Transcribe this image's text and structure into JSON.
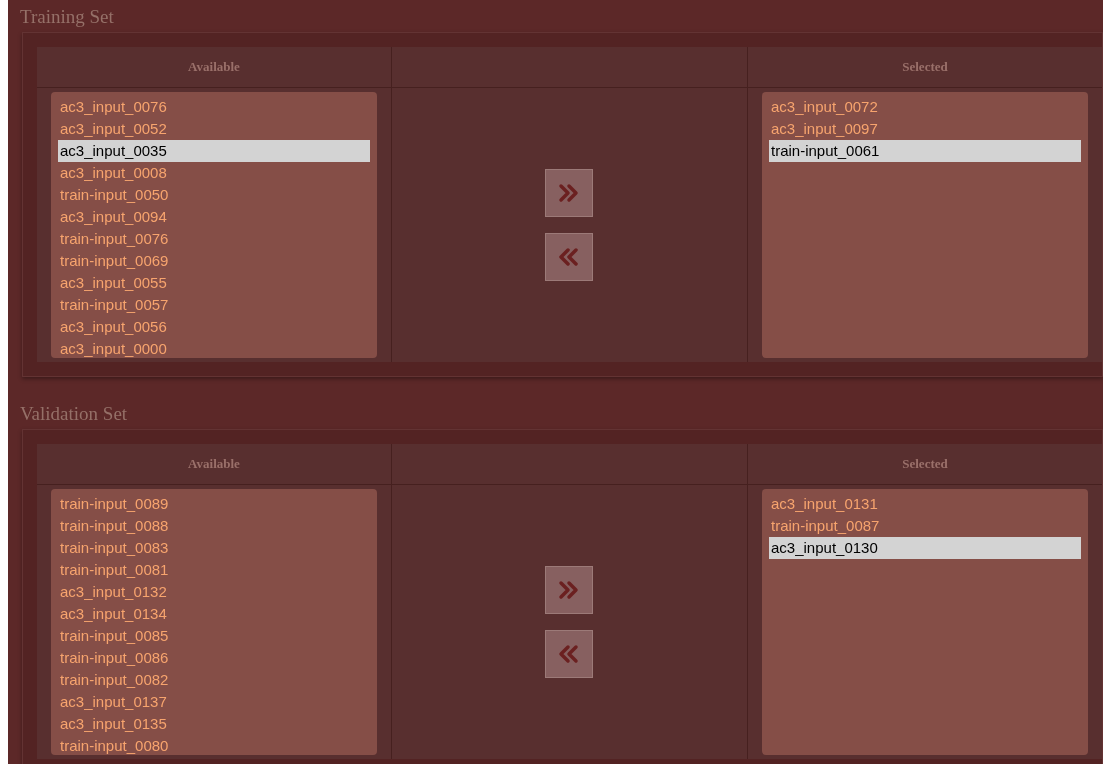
{
  "sections": [
    {
      "title": "Training Set",
      "available": {
        "heading": "Available",
        "items": [
          {
            "label": "ac3_input_0076",
            "selected": false
          },
          {
            "label": "ac3_input_0052",
            "selected": false
          },
          {
            "label": "ac3_input_0035",
            "selected": true
          },
          {
            "label": "ac3_input_0008",
            "selected": false
          },
          {
            "label": "train-input_0050",
            "selected": false
          },
          {
            "label": "ac3_input_0094",
            "selected": false
          },
          {
            "label": "train-input_0076",
            "selected": false
          },
          {
            "label": "train-input_0069",
            "selected": false
          },
          {
            "label": "ac3_input_0055",
            "selected": false
          },
          {
            "label": "train-input_0057",
            "selected": false
          },
          {
            "label": "ac3_input_0056",
            "selected": false
          },
          {
            "label": "ac3_input_0000",
            "selected": false
          }
        ]
      },
      "selected": {
        "heading": "Selected",
        "items": [
          {
            "label": "ac3_input_0072",
            "selected": false
          },
          {
            "label": "ac3_input_0097",
            "selected": false
          },
          {
            "label": "train-input_0061",
            "selected": true
          }
        ]
      }
    },
    {
      "title": "Validation Set",
      "available": {
        "heading": "Available",
        "items": [
          {
            "label": "train-input_0089",
            "selected": false
          },
          {
            "label": "train-input_0088",
            "selected": false
          },
          {
            "label": "train-input_0083",
            "selected": false
          },
          {
            "label": "train-input_0081",
            "selected": false
          },
          {
            "label": "ac3_input_0132",
            "selected": false
          },
          {
            "label": "ac3_input_0134",
            "selected": false
          },
          {
            "label": "train-input_0085",
            "selected": false
          },
          {
            "label": "train-input_0086",
            "selected": false
          },
          {
            "label": "train-input_0082",
            "selected": false
          },
          {
            "label": "ac3_input_0137",
            "selected": false
          },
          {
            "label": "ac3_input_0135",
            "selected": false
          },
          {
            "label": "train-input_0080",
            "selected": false
          }
        ]
      },
      "selected": {
        "heading": "Selected",
        "items": [
          {
            "label": "ac3_input_0131",
            "selected": false
          },
          {
            "label": "train-input_0087",
            "selected": false
          },
          {
            "label": "ac3_input_0130",
            "selected": true
          }
        ]
      }
    }
  ]
}
